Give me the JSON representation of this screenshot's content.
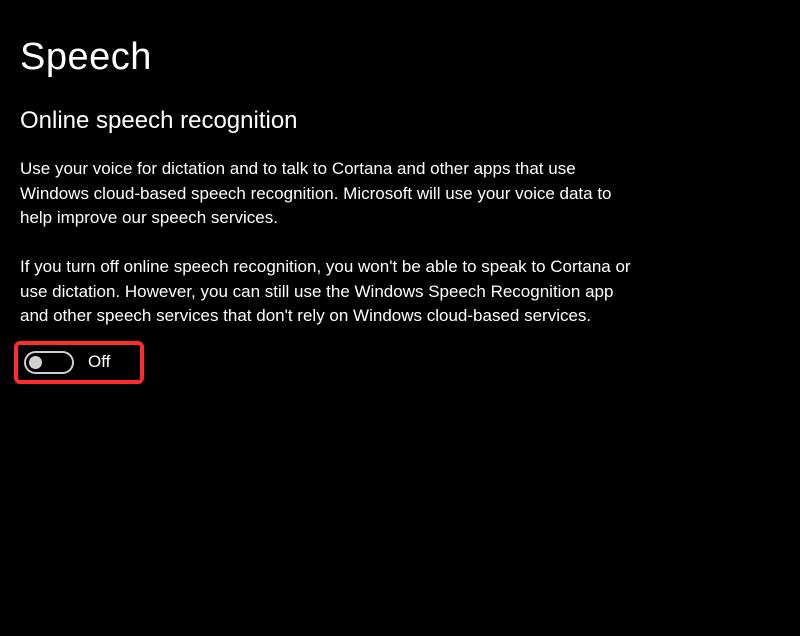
{
  "page": {
    "title": "Speech"
  },
  "section": {
    "heading": "Online speech recognition",
    "paragraph1": "Use your voice for dictation and to talk to Cortana and other apps that use Windows cloud-based speech recognition. Microsoft will use your voice data to help improve our speech services.",
    "paragraph2": "If you turn off online speech recognition, you won't be able to speak to Cortana or use dictation. However, you can still use the Windows Speech Recognition app and other speech services that don't rely on Windows cloud-based services."
  },
  "toggle": {
    "state_label": "Off"
  }
}
